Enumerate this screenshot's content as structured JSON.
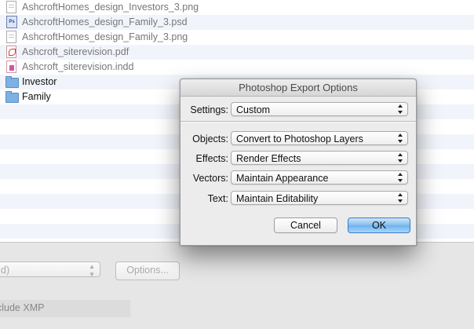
{
  "file_list": {
    "files": [
      {
        "name": "AshcroftHomes_design_Investors_3.png",
        "icon": "png-file-icon"
      },
      {
        "name": "AshcroftHomes_design_Family_3.psd",
        "icon": "psd-file-icon"
      },
      {
        "name": "AshcroftHomes_design_Family_3.png",
        "icon": "png-file-icon"
      },
      {
        "name": "Ashcroft_siterevision.pdf",
        "icon": "pdf-file-icon"
      },
      {
        "name": "Ashcroft_siterevision.indd",
        "icon": "indd-file-icon"
      },
      {
        "name": "Investor",
        "icon": "folder-icon"
      },
      {
        "name": "Family",
        "icon": "folder-icon"
      }
    ]
  },
  "bottom_panel": {
    "format_value": "d)",
    "options_button": "Options...",
    "include_xmp": "clude XMP"
  },
  "dialog": {
    "title": "Photoshop Export Options",
    "settings_label": "Settings:",
    "settings_value": "Custom",
    "objects_label": "Objects:",
    "objects_value": "Convert to Photoshop Layers",
    "effects_label": "Effects:",
    "effects_value": "Render Effects",
    "vectors_label": "Vectors:",
    "vectors_value": "Maintain Appearance",
    "text_label": "Text:",
    "text_value": "Maintain Editability",
    "cancel_button": "Cancel",
    "ok_button": "OK"
  },
  "colors": {
    "ok_button_blue": "#83bdf0",
    "row_alt": "#f1f5fb",
    "folder_blue": "#7db0e3"
  }
}
